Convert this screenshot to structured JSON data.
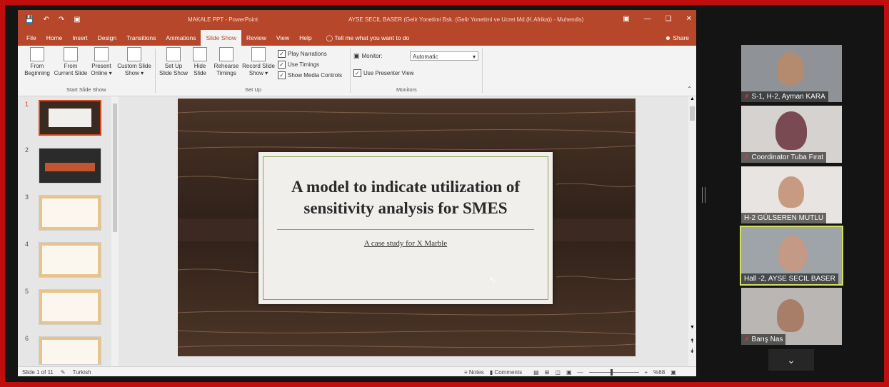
{
  "titlebar": {
    "doc_title": "MAKALE PPT  -  PowerPoint",
    "user": "AYSE SECIL BASER (Gelir Yonetimi Bsk. (Gelir Yonetimi ve Ucret Md.(K.Afrika)) - Muhendis)",
    "qat_icons": [
      "save-icon",
      "undo-icon",
      "redo-icon",
      "present-icon"
    ]
  },
  "tabs": [
    "File",
    "Home",
    "Insert",
    "Design",
    "Transitions",
    "Animations",
    "Slide Show",
    "Review",
    "View",
    "Help"
  ],
  "active_tab": "Slide Show",
  "tell_me": "Tell me what you want to do",
  "share": "Share",
  "ribbon": {
    "buttons": [
      {
        "line1": "From",
        "line2": "Beginning"
      },
      {
        "line1": "From",
        "line2": "Current Slide"
      },
      {
        "line1": "Present",
        "line2": "Online ▾"
      },
      {
        "line1": "Custom Slide",
        "line2": "Show ▾"
      },
      {
        "line1": "Set Up",
        "line2": "Slide Show"
      },
      {
        "line1": "Hide",
        "line2": "Slide"
      },
      {
        "line1": "Rehearse",
        "line2": "Timings"
      },
      {
        "line1": "Record Slide",
        "line2": "Show ▾"
      }
    ],
    "checks": [
      "Play Narrations",
      "Use Timings",
      "Show Media Controls"
    ],
    "monitor_label": "Monitor:",
    "monitor_value": "Automatic",
    "presenter_view": "Use Presenter View",
    "groups": [
      "Start Slide Show",
      "Set Up",
      "Monitors"
    ]
  },
  "thumbnails": [
    "1",
    "2",
    "3",
    "4",
    "5",
    "6"
  ],
  "slide": {
    "title": "A model to indicate utilization of sensitivity analysis for SMES",
    "subtitle": "A case study for X Marble"
  },
  "status": {
    "slide_count": "Slide 1 of 11",
    "language": "Turkish",
    "notes": "Notes",
    "comments": "Comments",
    "zoom": "%68"
  },
  "participants": [
    {
      "name": "S-1, H-2, Ayman KARA",
      "muted": true
    },
    {
      "name": "Coordinator Tuba Fırat",
      "muted": true
    },
    {
      "name": "H-2 GÜLSEREN MUTLU",
      "muted": false
    },
    {
      "name": "Hall -2, AYSE SECIL BASER",
      "muted": false,
      "speaking": true
    },
    {
      "name": "Barış Nas",
      "muted": true
    }
  ],
  "colors": {
    "frame": "#c00d0d",
    "ppt_accent": "#b7472a",
    "speaker_outline": "#d4e157"
  }
}
